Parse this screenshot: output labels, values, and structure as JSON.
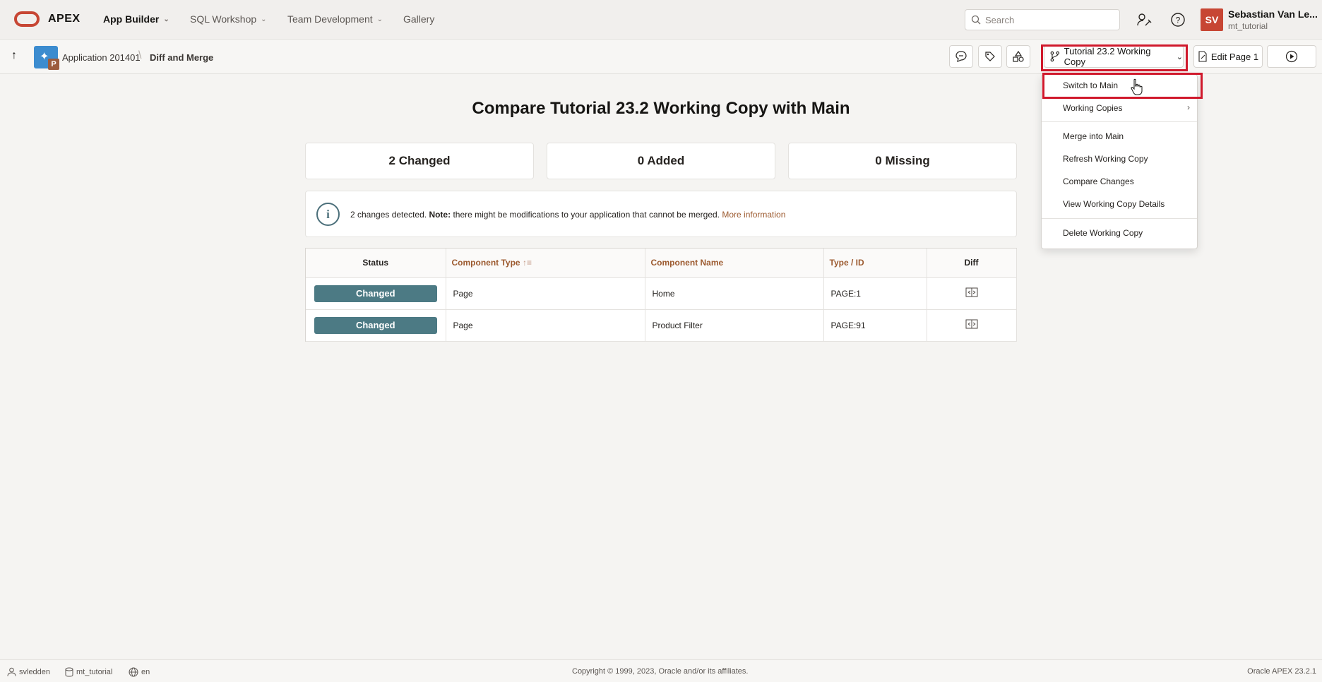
{
  "header": {
    "brand": "APEX",
    "nav": [
      {
        "label": "App Builder",
        "active": true
      },
      {
        "label": "SQL Workshop",
        "active": false
      },
      {
        "label": "Team Development",
        "active": false
      },
      {
        "label": "Gallery",
        "active": false
      }
    ],
    "search_placeholder": "Search",
    "avatar_initials": "SV",
    "user_name": "Sebastian Van Le...",
    "workspace": "mt_tutorial"
  },
  "toolbar": {
    "breadcrumb_app": "Application 201401",
    "breadcrumb_page": "Diff and Merge",
    "working_copy_label": "Tutorial 23.2 Working Copy",
    "edit_page_label": "Edit Page 1"
  },
  "main": {
    "title": "Compare Tutorial 23.2 Working Copy with Main",
    "stats": [
      "2 Changed",
      "0 Added",
      "0 Missing"
    ],
    "info": {
      "text": "2 changes detected.",
      "note_label": "Note:",
      "note_text": "there might be modifications to your application that cannot be merged.",
      "link": "More information"
    },
    "table": {
      "headers": [
        "Status",
        "Component Type",
        "Component Name",
        "Type / ID",
        "Diff"
      ],
      "rows": [
        {
          "status": "Changed",
          "type": "Page",
          "name": "Home",
          "id": "PAGE:1"
        },
        {
          "status": "Changed",
          "type": "Page",
          "name": "Product Filter",
          "id": "PAGE:91"
        }
      ]
    }
  },
  "menu": {
    "items": [
      "Switch to Main",
      "Working Copies",
      "Merge into Main",
      "Refresh Working Copy",
      "Compare Changes",
      "View Working Copy Details",
      "Delete Working Copy"
    ]
  },
  "footer": {
    "user": "svledden",
    "schema": "mt_tutorial",
    "language": "en",
    "copyright": "Copyright © 1999, 2023, Oracle and/or its affiliates.",
    "version": "Oracle APEX 23.2.1"
  },
  "colors": {
    "brand_red": "#c74634",
    "status_changed": "#4c7a84",
    "link": "#9c5a2f",
    "highlight": "#d0192c"
  }
}
